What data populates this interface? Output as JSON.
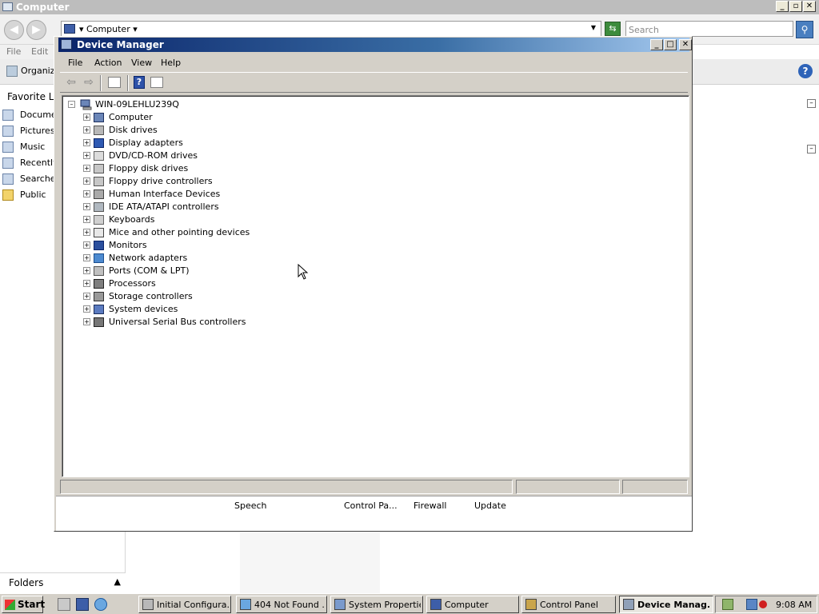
{
  "explorer": {
    "title": "Computer",
    "address": "Computer",
    "search_placeholder": "Search",
    "menu": [
      "File",
      "Edit"
    ],
    "organize_label": "Organiz",
    "favorite_links_title": "Favorite Lin",
    "favorites": [
      "Documen",
      "Pictures",
      "Music",
      "Recently",
      "Searches",
      "Public"
    ],
    "folders_label": "Folders",
    "bottom_items": [
      "Speech",
      "Control Pa...",
      "Firewall",
      "Update"
    ]
  },
  "device_manager": {
    "title": "Device Manager",
    "menu": [
      "File",
      "Action",
      "View",
      "Help"
    ],
    "root": "WIN-09LEHLU239Q",
    "categories": [
      {
        "label": "Computer",
        "icon": "computer-icon"
      },
      {
        "label": "Disk drives",
        "icon": "disk-drive-icon"
      },
      {
        "label": "Display adapters",
        "icon": "display-adapter-icon"
      },
      {
        "label": "DVD/CD-ROM drives",
        "icon": "dvd-drive-icon"
      },
      {
        "label": "Floppy disk drives",
        "icon": "floppy-drive-icon"
      },
      {
        "label": "Floppy drive controllers",
        "icon": "floppy-controller-icon"
      },
      {
        "label": "Human Interface Devices",
        "icon": "hid-icon"
      },
      {
        "label": "IDE ATA/ATAPI controllers",
        "icon": "ide-controller-icon"
      },
      {
        "label": "Keyboards",
        "icon": "keyboard-icon"
      },
      {
        "label": "Mice and other pointing devices",
        "icon": "mouse-icon"
      },
      {
        "label": "Monitors",
        "icon": "monitor-icon"
      },
      {
        "label": "Network adapters",
        "icon": "network-adapter-icon"
      },
      {
        "label": "Ports (COM & LPT)",
        "icon": "port-icon"
      },
      {
        "label": "Processors",
        "icon": "processor-icon"
      },
      {
        "label": "Storage controllers",
        "icon": "storage-controller-icon"
      },
      {
        "label": "System devices",
        "icon": "system-device-icon"
      },
      {
        "label": "Universal Serial Bus controllers",
        "icon": "usb-icon"
      }
    ],
    "toolbar_help_glyph": "?"
  },
  "taskbar": {
    "start_label": "Start",
    "tasks": [
      {
        "label": "Initial Configura...",
        "active": false
      },
      {
        "label": "404 Not Found ...",
        "active": false
      },
      {
        "label": "System Properties",
        "active": false
      },
      {
        "label": "Computer",
        "active": false
      },
      {
        "label": "Control Panel",
        "active": false
      },
      {
        "label": "Device Manag...",
        "active": true
      }
    ],
    "clock": "9:08 AM"
  },
  "colors": {
    "title_gradient_start": "#0a246a",
    "title_gradient_end": "#a6caf0",
    "window_face": "#d4d0c8"
  }
}
